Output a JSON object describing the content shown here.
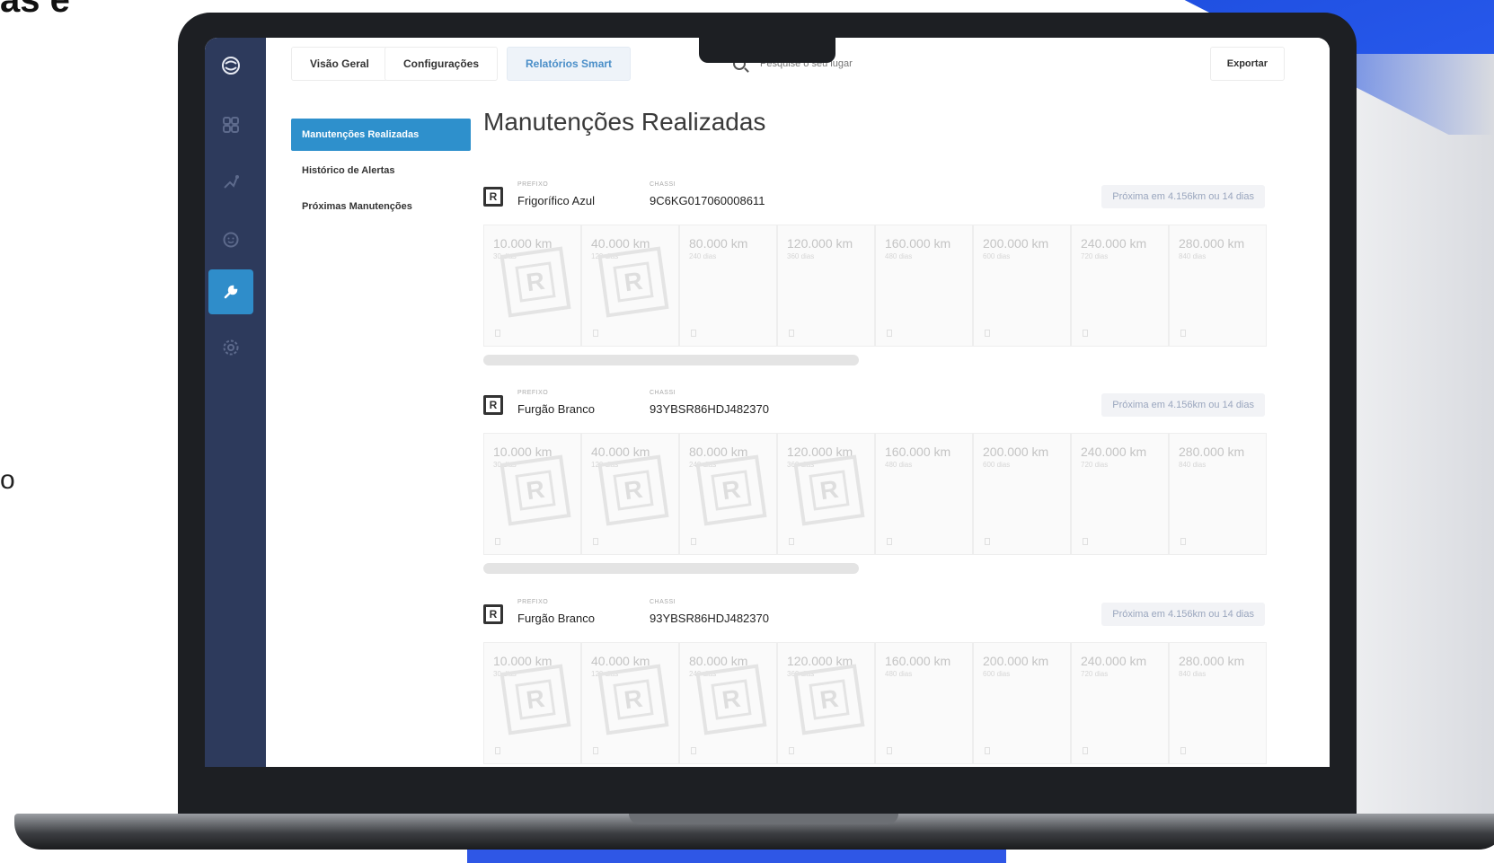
{
  "backdrop": {
    "top_edge_text": "as e",
    "mid_edge_text": "o"
  },
  "sidenav": {
    "logo": "logo-icon",
    "items": [
      {
        "icon": "dashboard-icon",
        "glyph": "▦"
      },
      {
        "icon": "route-icon",
        "glyph": "⚒"
      },
      {
        "icon": "smiley-icon",
        "glyph": "☺"
      },
      {
        "icon": "wrench-icon",
        "glyph": "🔧",
        "active": true
      },
      {
        "icon": "gear-icon",
        "glyph": "⚙"
      }
    ]
  },
  "topbar": {
    "tabs": [
      {
        "label": "Visão Geral",
        "active": false
      },
      {
        "label": "Configurações",
        "active": false
      },
      {
        "label": "Relatórios Smart",
        "active": true
      }
    ],
    "search_placeholder": "Pesquise o seu lugar",
    "export_label": "Exportar"
  },
  "submenu": {
    "items": [
      {
        "label": "Manutenções Realizadas",
        "active": true
      },
      {
        "label": "Histórico de Alertas",
        "active": false
      },
      {
        "label": "Próximas Manutenções",
        "active": false
      }
    ]
  },
  "main": {
    "title": "Manutenções Realizadas",
    "vehicles": [
      {
        "icon_letter": "R",
        "prefix_label": "PREFIXO",
        "prefix_value": "Frigorífico Azul",
        "chassis_label": "CHASSI",
        "chassis_value": "9C6KG017060008611",
        "next_badge": "Próxima em 4.156km ou 14 dias",
        "cards": [
          {
            "km": "10.000 km",
            "days": "30 dias",
            "done": true
          },
          {
            "km": "40.000 km",
            "days": "120 dias",
            "done": true
          },
          {
            "km": "80.000 km",
            "days": "240 dias",
            "done": false
          },
          {
            "km": "120.000 km",
            "days": "360 dias",
            "done": false
          },
          {
            "km": "160.000 km",
            "days": "480 dias",
            "done": false
          },
          {
            "km": "200.000 km",
            "days": "600 dias",
            "done": false
          },
          {
            "km": "240.000 km",
            "days": "720 dias",
            "done": false
          },
          {
            "km": "280.000 km",
            "days": "840 dias",
            "done": false
          }
        ]
      },
      {
        "icon_letter": "R",
        "prefix_label": "PREFIXO",
        "prefix_value": "Furgão Branco",
        "chassis_label": "CHASSI",
        "chassis_value": "93YBSR86HDJ482370",
        "next_badge": "Próxima em 4.156km ou 14 dias",
        "cards": [
          {
            "km": "10.000 km",
            "days": "30 dias",
            "done": true
          },
          {
            "km": "40.000 km",
            "days": "120 dias",
            "done": true
          },
          {
            "km": "80.000 km",
            "days": "240 dias",
            "done": true
          },
          {
            "km": "120.000 km",
            "days": "360 dias",
            "done": true
          },
          {
            "km": "160.000 km",
            "days": "480 dias",
            "done": false
          },
          {
            "km": "200.000 km",
            "days": "600 dias",
            "done": false
          },
          {
            "km": "240.000 km",
            "days": "720 dias",
            "done": false
          },
          {
            "km": "280.000 km",
            "days": "840 dias",
            "done": false
          }
        ]
      },
      {
        "icon_letter": "R",
        "prefix_label": "PREFIXO",
        "prefix_value": "Furgão Branco",
        "chassis_label": "CHASSI",
        "chassis_value": "93YBSR86HDJ482370",
        "next_badge": "Próxima em 4.156km ou 14 dias",
        "cards": [
          {
            "km": "10.000 km",
            "days": "30 dias",
            "done": true
          },
          {
            "km": "40.000 km",
            "days": "120 dias",
            "done": true
          },
          {
            "km": "80.000 km",
            "days": "240 dias",
            "done": true
          },
          {
            "km": "120.000 km",
            "days": "360 dias",
            "done": true
          },
          {
            "km": "160.000 km",
            "days": "480 dias",
            "done": false
          },
          {
            "km": "200.000 km",
            "days": "600 dias",
            "done": false
          },
          {
            "km": "240.000 km",
            "days": "720 dias",
            "done": false
          },
          {
            "km": "280.000 km",
            "days": "840 dias",
            "done": false
          }
        ]
      }
    ]
  },
  "colors": {
    "nav_bg": "#2d3a5c",
    "accent": "#2e90cc",
    "brand_blue": "#1f4fe0"
  }
}
